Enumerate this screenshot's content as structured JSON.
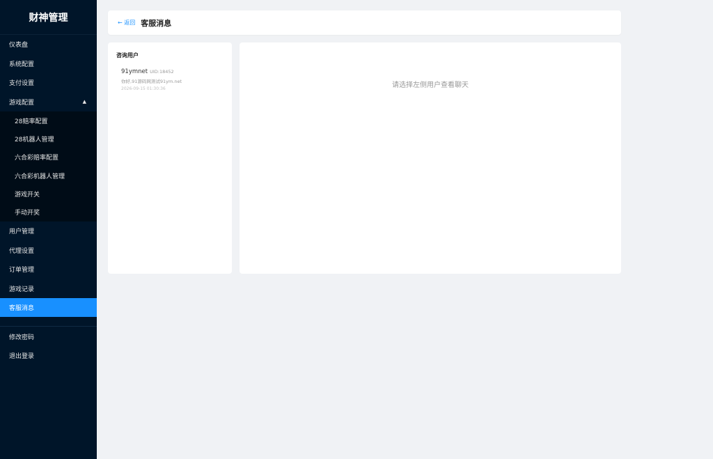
{
  "sidebar": {
    "logo": "财神管理",
    "items": [
      {
        "label": "仪表盘"
      },
      {
        "label": "系统配置"
      },
      {
        "label": "支付设置"
      },
      {
        "label": "游戏配置",
        "arrow": "▲"
      },
      {
        "label": "用户管理"
      },
      {
        "label": "代理设置"
      },
      {
        "label": "订单管理"
      },
      {
        "label": "游戏记录"
      },
      {
        "label": "客服消息"
      }
    ],
    "submenu": [
      {
        "label": "28赔率配置"
      },
      {
        "label": "28机器人管理"
      },
      {
        "label": "六合彩赔率配置"
      },
      {
        "label": "六合彩机器人管理"
      },
      {
        "label": "游戏开关"
      },
      {
        "label": "手动开奖"
      }
    ],
    "bottom": [
      {
        "label": "修改密码"
      },
      {
        "label": "退出登录"
      }
    ],
    "active": "客服消息"
  },
  "header": {
    "back_label": "← 返回",
    "title": "客服消息"
  },
  "users_panel": {
    "title": "咨询用户",
    "users": [
      {
        "name": "91ymnet",
        "uid": "UID:18452",
        "last_message": "你好,91源码网测试91ym.net",
        "time": "2026-09-15 01:30:36"
      }
    ]
  },
  "chat_panel": {
    "empty_hint": "请选择左侧用户查看聊天"
  },
  "colors": {
    "sidebar_bg": "#001529",
    "accent": "#1890ff",
    "page_bg": "#f0f2f5"
  }
}
